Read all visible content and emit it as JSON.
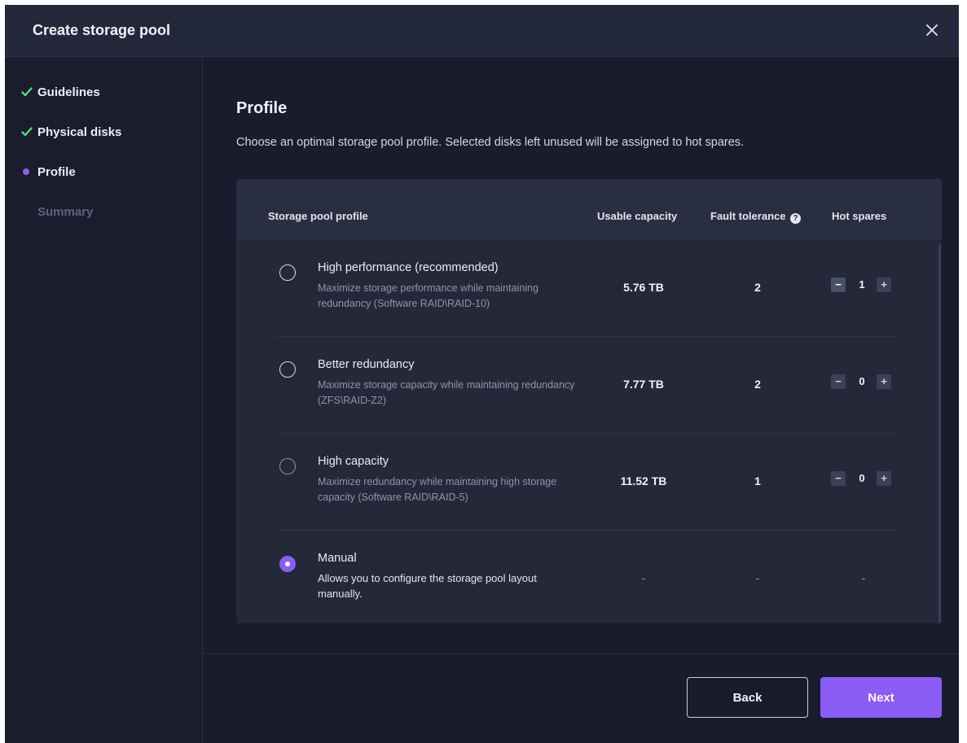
{
  "dialog": {
    "title": "Create storage pool",
    "close_icon": "close-icon"
  },
  "sidebar": {
    "steps": [
      {
        "label": "Guidelines",
        "state": "done",
        "icon": "check-icon"
      },
      {
        "label": "Physical disks",
        "state": "done",
        "icon": "check-icon"
      },
      {
        "label": "Profile",
        "state": "current",
        "icon": "dot-icon"
      },
      {
        "label": "Summary",
        "state": "pending"
      }
    ]
  },
  "main": {
    "title": "Profile",
    "description": "Choose an optimal storage pool profile. Selected disks left unused will be assigned to hot spares."
  },
  "table": {
    "headers": {
      "profile": "Storage pool profile",
      "capacity": "Usable capacity",
      "fault_tolerance": "Fault tolerance",
      "hot_spares": "Hot spares"
    },
    "rows": [
      {
        "name": "High performance (recommended)",
        "description": "Maximize storage performance while maintaining redundancy (Software RAID\\RAID-10)",
        "capacity": "5.76 TB",
        "fault_tolerance": "2",
        "hot_spares": "1",
        "selected": false
      },
      {
        "name": "Better redundancy",
        "description": "Maximize storage capacity while maintaining redundancy (ZFS\\RAID-Z2)",
        "capacity": "7.77 TB",
        "fault_tolerance": "2",
        "hot_spares": "0",
        "selected": false
      },
      {
        "name": "High capacity",
        "description": "Maximize redundancy while maintaining high storage capacity (Software RAID\\RAID-5)",
        "capacity": "11.52 TB",
        "fault_tolerance": "1",
        "hot_spares": "0",
        "selected": false
      },
      {
        "name": "Manual",
        "description": "Allows you to configure the storage pool layout manually.",
        "capacity": "-",
        "fault_tolerance": "-",
        "hot_spares": "-",
        "selected": true
      }
    ],
    "stepper": {
      "minus": "−",
      "plus": "+"
    },
    "help_glyph": "?"
  },
  "footer": {
    "back_label": "Back",
    "next_label": "Next"
  },
  "colors": {
    "accent": "#8b5cf6",
    "check": "#4ade80",
    "background": "#191c2c",
    "panel": "#242839"
  }
}
